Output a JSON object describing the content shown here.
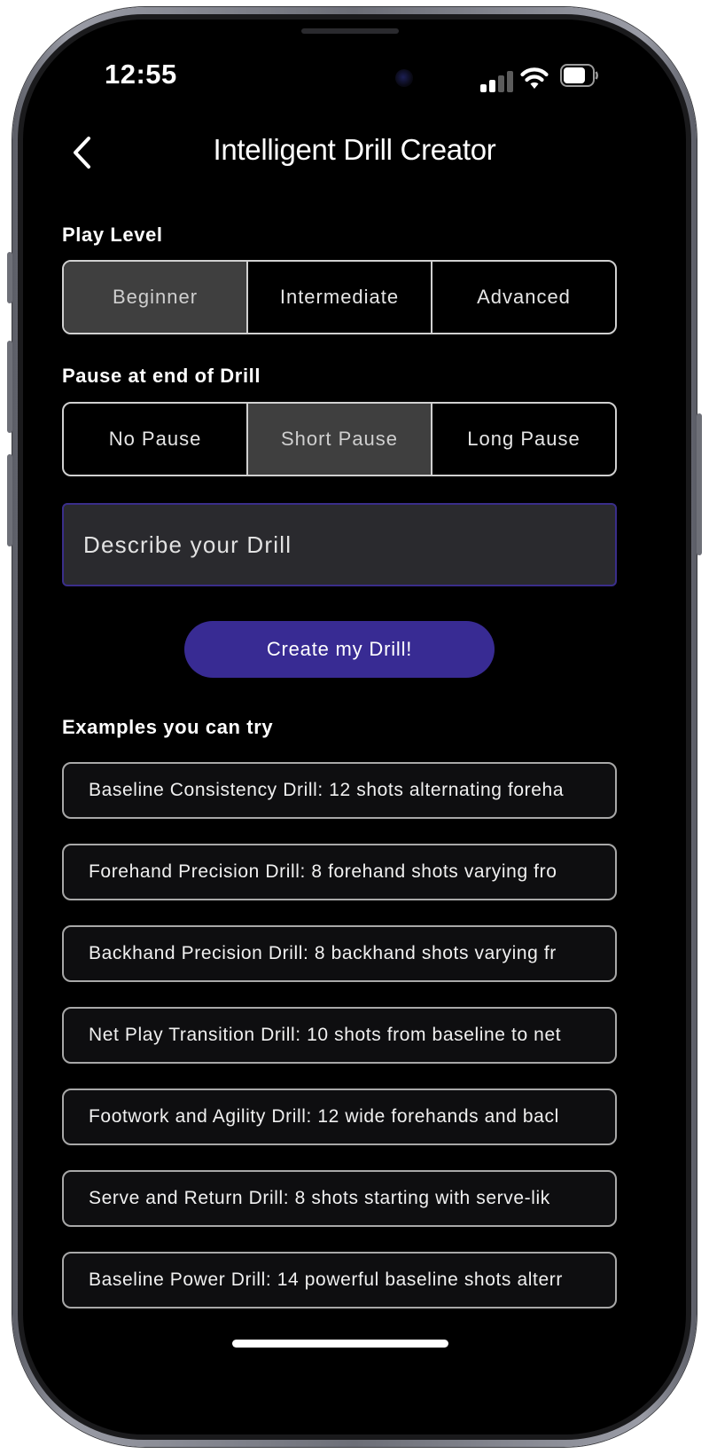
{
  "status_bar": {
    "time": "12:55"
  },
  "header": {
    "title": "Intelligent Drill Creator"
  },
  "play_level": {
    "label": "Play Level",
    "options": [
      "Beginner",
      "Intermediate",
      "Advanced"
    ],
    "selected": "Beginner"
  },
  "pause": {
    "label": "Pause at end of Drill",
    "options": [
      "No Pause",
      "Short Pause",
      "Long Pause"
    ],
    "selected": "Short Pause"
  },
  "describe": {
    "placeholder": "Describe your Drill",
    "value": ""
  },
  "create_button": {
    "label": "Create my Drill!"
  },
  "examples": {
    "label": "Examples you can try",
    "items": [
      "Baseline Consistency Drill: 12 shots alternating foreha",
      "Forehand Precision Drill: 8 forehand shots varying fro",
      "Backhand Precision Drill: 8 backhand shots varying fr",
      "Net Play Transition Drill: 10 shots from baseline to net",
      "Footwork and Agility Drill: 12 wide forehands and bacl",
      "Serve and Return Drill: 8 shots starting with serve-lik",
      "Baseline Power Drill: 14 powerful baseline shots alterr"
    ]
  },
  "colors": {
    "accent": "#382b93",
    "input_border": "#3a2e8a",
    "selected_segment": "#3f3f3f",
    "background": "#000000"
  },
  "icons": {
    "back": "chevron-left-icon",
    "signal": "cellular-signal-icon",
    "wifi": "wifi-icon",
    "battery": "battery-icon"
  }
}
